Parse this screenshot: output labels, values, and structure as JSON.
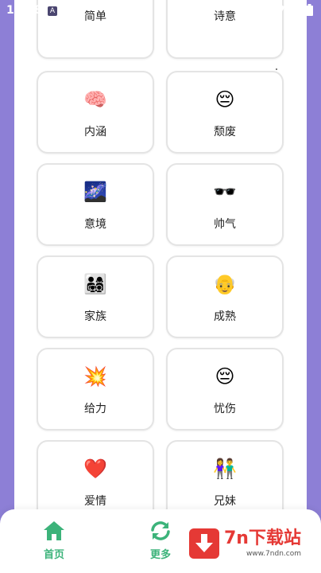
{
  "status_bar": {
    "time": "11:18",
    "notification_badge": "A"
  },
  "cards": [
    {
      "emoji": "",
      "label": "简单"
    },
    {
      "emoji": "",
      "label": "诗意"
    },
    {
      "emoji": "🧠",
      "label": "内涵"
    },
    {
      "emoji": "😔",
      "label": "颓废"
    },
    {
      "emoji": "🌌",
      "label": "意境"
    },
    {
      "emoji": "🕶️",
      "label": "帅气"
    },
    {
      "emoji": "👨‍👩‍👧‍👦",
      "label": "家族"
    },
    {
      "emoji": "👴",
      "label": "成熟"
    },
    {
      "emoji": "💥",
      "label": "给力"
    },
    {
      "emoji": "😔",
      "label": "忧伤"
    },
    {
      "emoji": "❤️",
      "label": "爱情"
    },
    {
      "emoji": "👫",
      "label": "兄妹"
    }
  ],
  "top_note_emoji": "📝",
  "nav": {
    "home_label": "首页",
    "more_label": "更多",
    "accent_color": "#3cb37a"
  },
  "watermark": {
    "title": "7n下载站",
    "url": "www.7ndn.com"
  }
}
